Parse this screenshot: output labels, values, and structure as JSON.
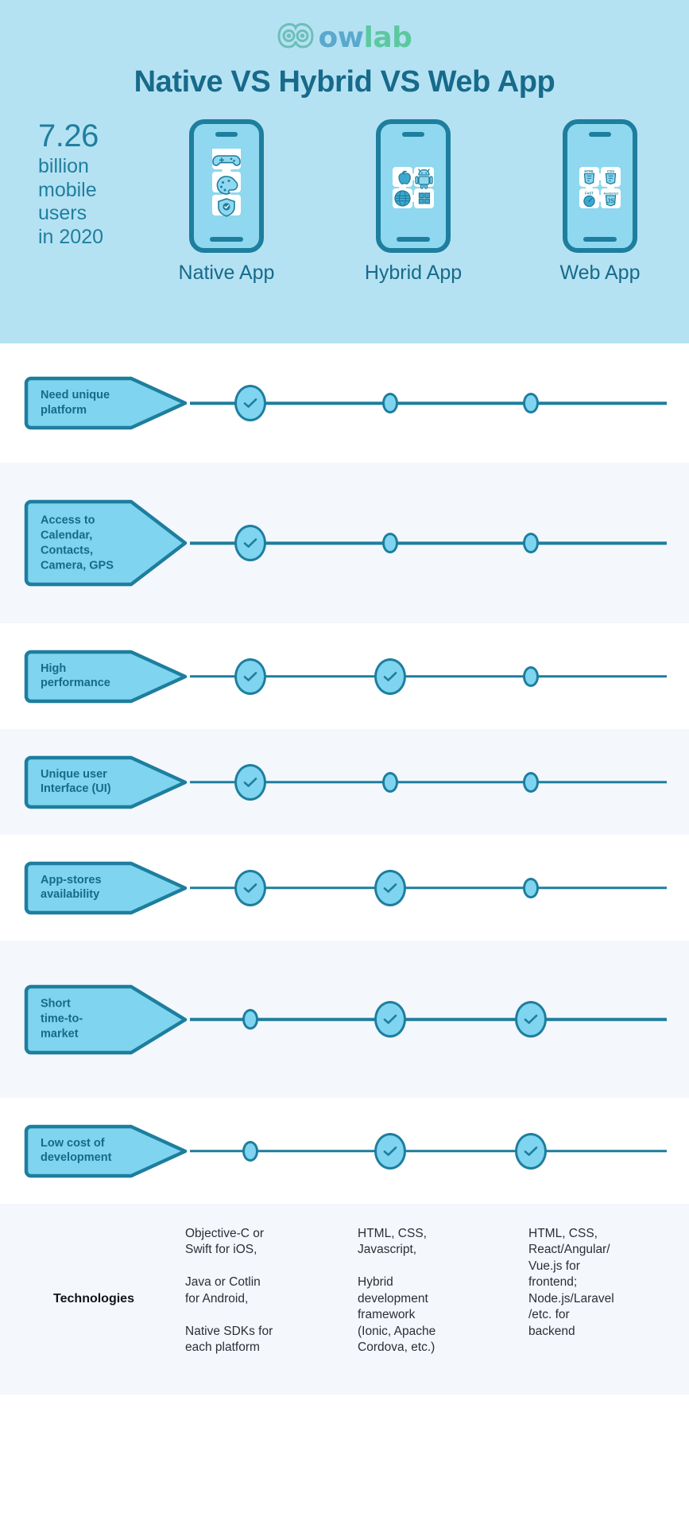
{
  "brand": {
    "logo_text_part1": "ow",
    "logo_text_part2": "lab",
    "logo_icon": "owl-icon",
    "colors": {
      "header_bg": "#b5e2f3",
      "deep_teal": "#176a8a",
      "line_teal": "#1d7e9e",
      "node_fill": "#7fd4ef",
      "row_alt_bg": "#f4f7fc",
      "logo_ow": "#5aa9cc",
      "logo_lab": "#5cc8a0"
    }
  },
  "header": {
    "title": "Native VS Hybrid VS Web App",
    "stat_number": "7.26",
    "stat_rest": "billion\nmobile\nusers\nin 2020",
    "phones": [
      {
        "label": "Native App",
        "tiles": [
          "gamepad-icon",
          "palette-icon",
          "shield-check-icon"
        ],
        "layout": "column-3"
      },
      {
        "label": "Hybrid App",
        "tiles": [
          "apple-icon",
          "android-icon",
          "globe-icon",
          "windows-icon"
        ],
        "layout": "grid-4"
      },
      {
        "label": "Web App",
        "tiles": [
          "html5-icon",
          "css3-icon",
          "speedometer-fast-icon",
          "javascript-icon"
        ],
        "layout": "grid-4"
      }
    ]
  },
  "comparison": {
    "columns": [
      "Native App",
      "Hybrid App",
      "Web App"
    ],
    "rows": [
      {
        "criterion": "Need unique\nplatform",
        "native": true,
        "hybrid": false,
        "web": false
      },
      {
        "criterion": "Access to\nCalendar,\nContacts,\nCamera, GPS",
        "native": true,
        "hybrid": false,
        "web": false
      },
      {
        "criterion": "High\nperformance",
        "native": true,
        "hybrid": true,
        "web": false
      },
      {
        "criterion": "Unique user\nInterface (UI)",
        "native": true,
        "hybrid": false,
        "web": false
      },
      {
        "criterion": "App-stores\navailability",
        "native": true,
        "hybrid": true,
        "web": false
      },
      {
        "criterion": "Short\ntime-to-\nmarket",
        "native": false,
        "hybrid": true,
        "web": true
      },
      {
        "criterion": "Low cost of\ndevelopment",
        "native": false,
        "hybrid": true,
        "web": true
      }
    ]
  },
  "technologies": {
    "label": "Technologies",
    "native": "Objective-C or\nSwift for iOS,\n\nJava or Cotlin\nfor Android,\n\nNative SDKs for\neach platform",
    "hybrid": "HTML, CSS,\nJavascript,\n\nHybrid\ndevelopment\nframework\n(Ionic, Apache\nCordova, etc.)",
    "web": "HTML, CSS,\nReact/Angular/\nVue.js for\nfrontend;\nNode.js/Laravel\n/etc. for\nbackend"
  }
}
